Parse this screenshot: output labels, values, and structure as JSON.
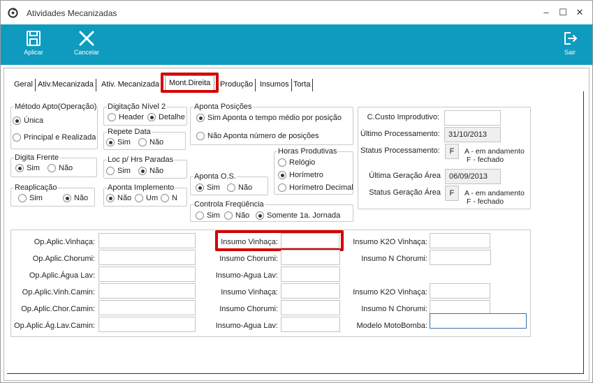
{
  "window": {
    "title": "Atividades Mecanizadas",
    "controls": {
      "minimize": "–",
      "maximize": "☐",
      "close": "✕"
    }
  },
  "toolbar": {
    "apply_label": "Aplicar",
    "cancel_label": "Cancelar",
    "exit_label": "Sair",
    "color": "#0f9bbf"
  },
  "tabs": [
    "Geral",
    "Ativ.Mecanizada",
    "Ativ. Mecanizada",
    "Mont.Direita",
    "Produção",
    "Insumos",
    "Torta"
  ],
  "active_tab": "Mont.Direita",
  "highlight_color": "#d40000",
  "groups": {
    "metodo": {
      "title": "Método Apto(Operação)",
      "options": [
        "Única",
        "Principal e Realizada"
      ],
      "selected": "Única"
    },
    "digitacao": {
      "title": "Digitação Nível 2",
      "options": [
        "Header",
        "Detalhe"
      ],
      "selected": "Detalhe"
    },
    "repete": {
      "title": "Repete Data",
      "options": [
        "Sim",
        "Não"
      ],
      "selected": "Sim"
    },
    "aponta_posicoes": {
      "title": "Aponta Posições",
      "options": [
        "Sim  Aponta o tempo médio por posição",
        "Não  Aponta número de posições"
      ],
      "selected": "Sim  Aponta o tempo médio por posição"
    },
    "digita_frente": {
      "title": "Digita Frente",
      "options": [
        "Sim",
        "Não"
      ],
      "selected": "Sim"
    },
    "loc_hrs": {
      "title": "Loc p/ Hrs Paradas",
      "options": [
        "Sim",
        "Não"
      ],
      "selected": "Não"
    },
    "horas_produtivas": {
      "title": "Horas Produtivas",
      "options": [
        "Relógio",
        "Horímetro",
        "Horímetro Decimal"
      ],
      "selected": "Horímetro"
    },
    "aponta_os": {
      "title": "Aponta O.S.",
      "options": [
        "Sim",
        "Não"
      ],
      "selected": "Sim"
    },
    "reaplicacao": {
      "title": "Reaplicação",
      "options": [
        "Sim",
        "Não"
      ],
      "selected": "Não"
    },
    "aponta_implemento": {
      "title": "Aponta Implemento",
      "options": [
        "Não",
        "Um",
        "N"
      ],
      "selected": "Não"
    },
    "controla_frequencia": {
      "title": "Controla Freqüência",
      "options": [
        "Sim",
        "Não",
        "Somente 1a. Jornada"
      ],
      "selected": "Somente 1a. Jornada"
    }
  },
  "status_panel": {
    "ccusto_label": "C.Custo Improdutivo:",
    "ccusto_value": "",
    "ultimo_proc_label": "Último Processamento:",
    "ultimo_proc_value": "31/10/2013",
    "status_proc_label": "Status Processamento:",
    "status_proc_value": "F",
    "status_proc_note_a": "A - em andamento",
    "status_proc_note_f": "F - fechado",
    "ultima_ger_label": "Última Geração Área",
    "ultima_ger_value": "06/09/2013",
    "status_ger_label": "Status Geração Área",
    "status_ger_value": "F",
    "status_ger_note_a": "A - em andamento",
    "status_ger_note_f": "F - fechado"
  },
  "fields": {
    "col1": [
      "Op.Aplic.Vinhaça:",
      "Op.Aplic.Chorumi:",
      "Op.Aplic.Água Lav:",
      "Op.Aplic.Vinh.Camin:",
      "Op.Aplic.Chor.Camin:",
      "Op.Aplic.Ág.Lav.Camin:"
    ],
    "col2": [
      "Insumo Vinhaça:",
      "Insumo Chorumi:",
      "Insumo-Agua Lav:",
      "Insumo Vinhaça:",
      "Insumo Chorumi:",
      "Insumo-Agua Lav:"
    ],
    "col3": [
      "Insumo K2O Vinhaça:",
      "Insumo N Chorumi:",
      "",
      "Insumo K2O Vinhaça:",
      "Insumo N Chorumi:",
      "Modelo MotoBomba:"
    ]
  }
}
